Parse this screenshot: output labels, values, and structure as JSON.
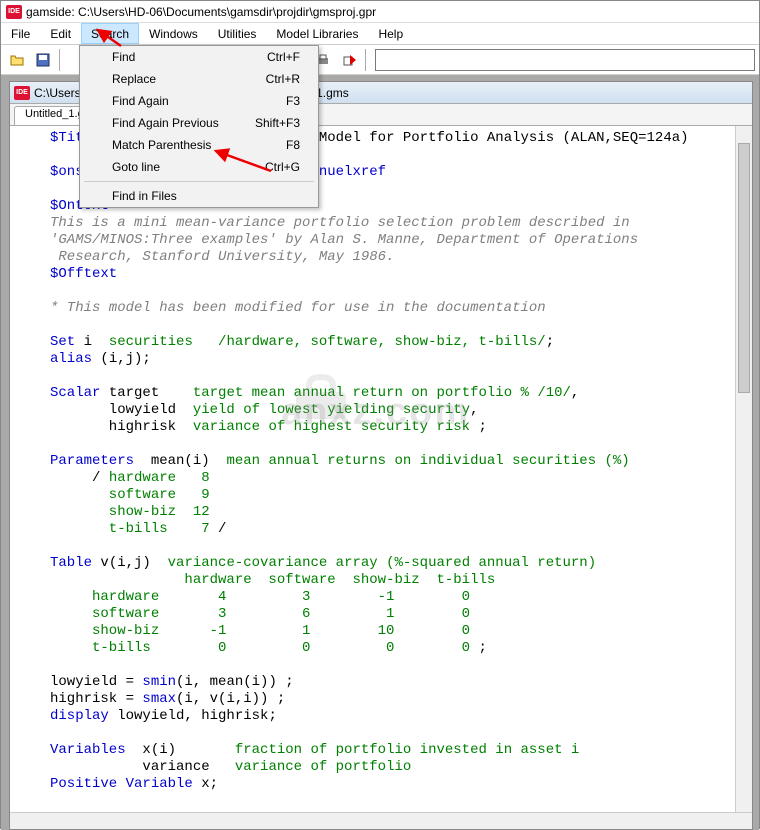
{
  "window": {
    "title": "gamside: C:\\Users\\HD-06\\Documents\\gamsdir\\projdir\\gmsproj.gpr"
  },
  "menubar": [
    "File",
    "Edit",
    "Search",
    "Windows",
    "Utilities",
    "Model Libraries",
    "Help"
  ],
  "dropdown": {
    "items": [
      {
        "label": "Find",
        "shortcut": "Ctrl+F"
      },
      {
        "label": "Replace",
        "shortcut": "Ctrl+R"
      },
      {
        "label": "Find Again",
        "shortcut": "F3"
      },
      {
        "label": "Find Again Previous",
        "shortcut": "Shift+F3"
      },
      {
        "label": "Match Parenthesis",
        "shortcut": "F8"
      },
      {
        "label": "Goto line",
        "shortcut": "Ctrl+G"
      }
    ],
    "footer": {
      "label": "Find in Files",
      "shortcut": ""
    }
  },
  "child_window": {
    "title": "C:\\Users\\HD-06\\Documents\\gamsdir\\projdir\\Untitled_1.gms",
    "tab": "Untitled_1.gms"
  },
  "code": {
    "l1a": "$Title",
    "l1b": "  A Quadratic Programming Model for Portfolio Analysis (ALAN,SEQ=124a)",
    "l2": "",
    "l3a": "$onsymlist onsymxref onuellist onuelxref",
    "l4": "",
    "l5a": "$Ontext",
    "l6": "This is a mini mean-variance portfolio selection problem described in",
    "l7": "'GAMS/MINOS:Three examples' by Alan S. Manne, Department of Operations",
    "l8": " Research, Stanford University, May 1986.",
    "l9a": "$Offtext",
    "l10": "",
    "l11": "* This model has been modified for use in the documentation",
    "l12": "",
    "l13a": "Set",
    "l13b": " i  ",
    "l13c": "securities   /hardware, software, show-biz, t-bills/",
    "l13d": ";",
    "l14a": "alias",
    "l14b": " (i,j);",
    "l15": "",
    "l16a": "Scalar",
    "l16b": " target    ",
    "l16c": "target mean annual return on portfolio % ",
    "l16d": "/10/",
    "l16e": ",",
    "l17a": "       lowyield  ",
    "l17b": "yield of lowest yielding security",
    "l17c": ",",
    "l18a": "       highrisk  ",
    "l18b": "variance of highest security risk ",
    "l18c": ";",
    "l19": "",
    "l20a": "Parameters",
    "l20b": "  mean(i)  ",
    "l20c": "mean annual returns on individual securities (%)",
    "l21a": "     / ",
    "l21b": "hardware   8",
    "l22": "       software   9",
    "l23": "       show-biz  12",
    "l24a": "       t-bills    7",
    "l24b": " /",
    "l25": "",
    "l26a": "Table",
    "l26b": " v(i,j)  ",
    "l26c": "variance-covariance array (%-squared annual return)",
    "l27": "                hardware  software  show-biz  t-bills",
    "l28": "     hardware       4         3        -1        0",
    "l29": "     software       3         6         1        0",
    "l30": "     show-biz      -1         1        10        0",
    "l31a": "     t-bills        0         0         0        0 ",
    "l31b": ";",
    "l32": "",
    "l33a": "lowyield = ",
    "l33b": "smin",
    "l33c": "(i, mean(i)) ;",
    "l34a": "highrisk = ",
    "l34b": "smax",
    "l34c": "(i, v(i,i)) ;",
    "l35a": "display",
    "l35b": " lowyield, highrisk;",
    "l36": "",
    "l37a": "Variables",
    "l37b": "  x(i)       ",
    "l37c": "fraction of portfolio invested in asset i",
    "l38a": "           variance   ",
    "l38b": "variance of portfolio",
    "l39a": "Positive Variable",
    "l39b": " x;"
  },
  "watermark": "anxz.com"
}
